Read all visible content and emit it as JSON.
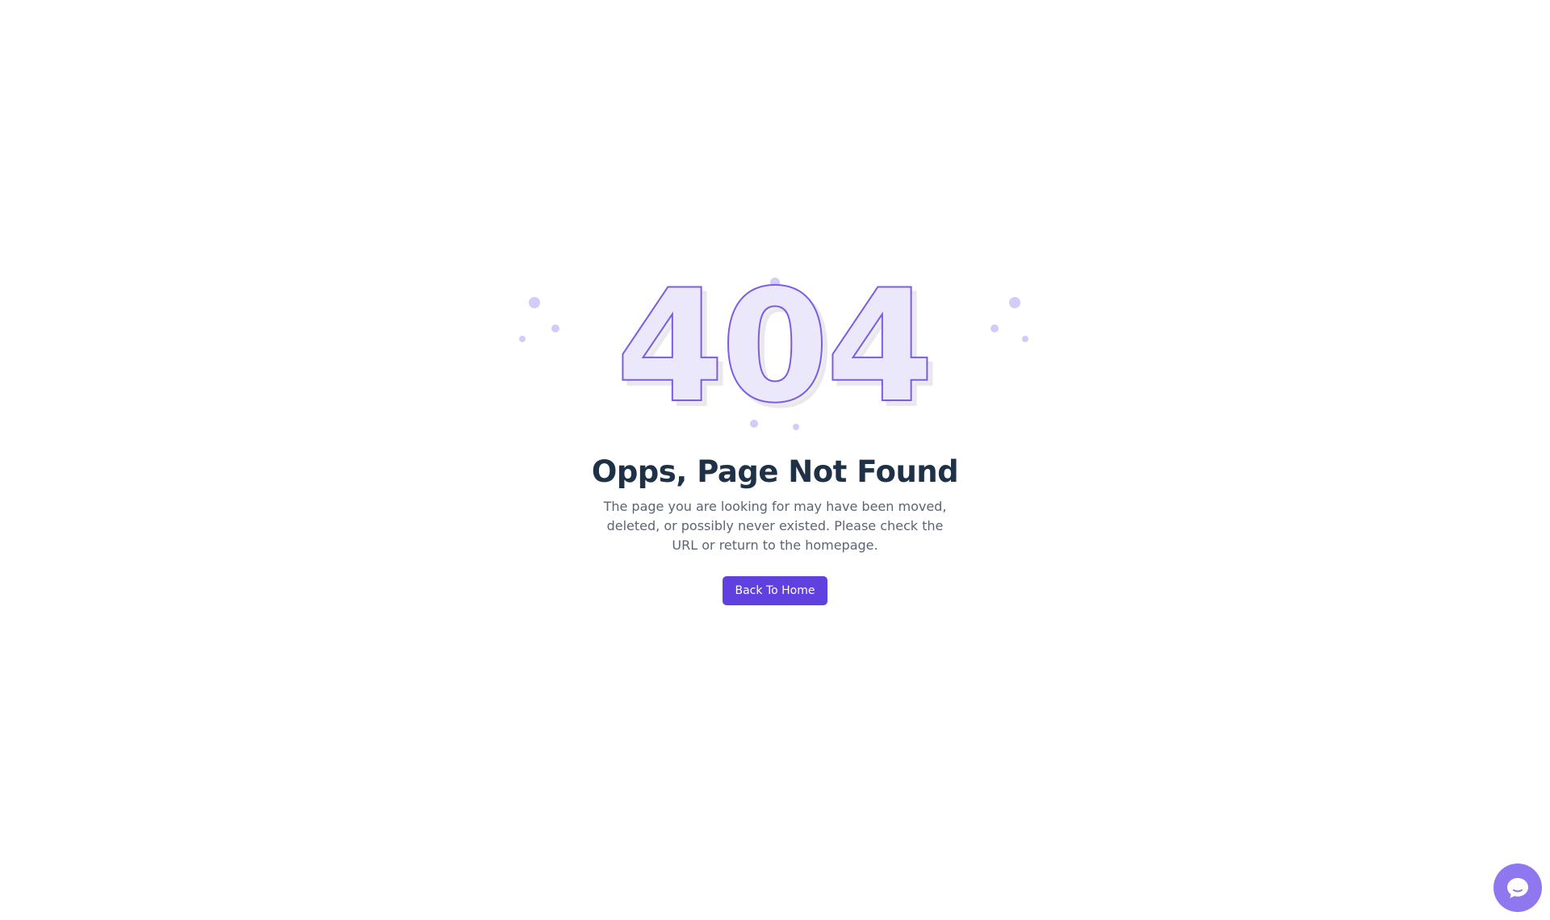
{
  "error": {
    "code_digits": [
      "4",
      "0",
      "4"
    ]
  },
  "content": {
    "title": "Opps, Page Not Found",
    "description": "The page you are looking for may have been moved, deleted, or possibly never existed. Please check the URL or return to the homepage.",
    "button_label": "Back To Home"
  },
  "chat_widget": {
    "icon": "chat-bubble-icon"
  },
  "colors": {
    "accent": "#6041e0",
    "digit_stroke": "#7c5ce6",
    "digit_fill": "#ece8fb",
    "decor_dot": "#d4cbf8",
    "title": "#1f3147",
    "text": "#5c6472",
    "chat_widget": "#8f77ef"
  }
}
